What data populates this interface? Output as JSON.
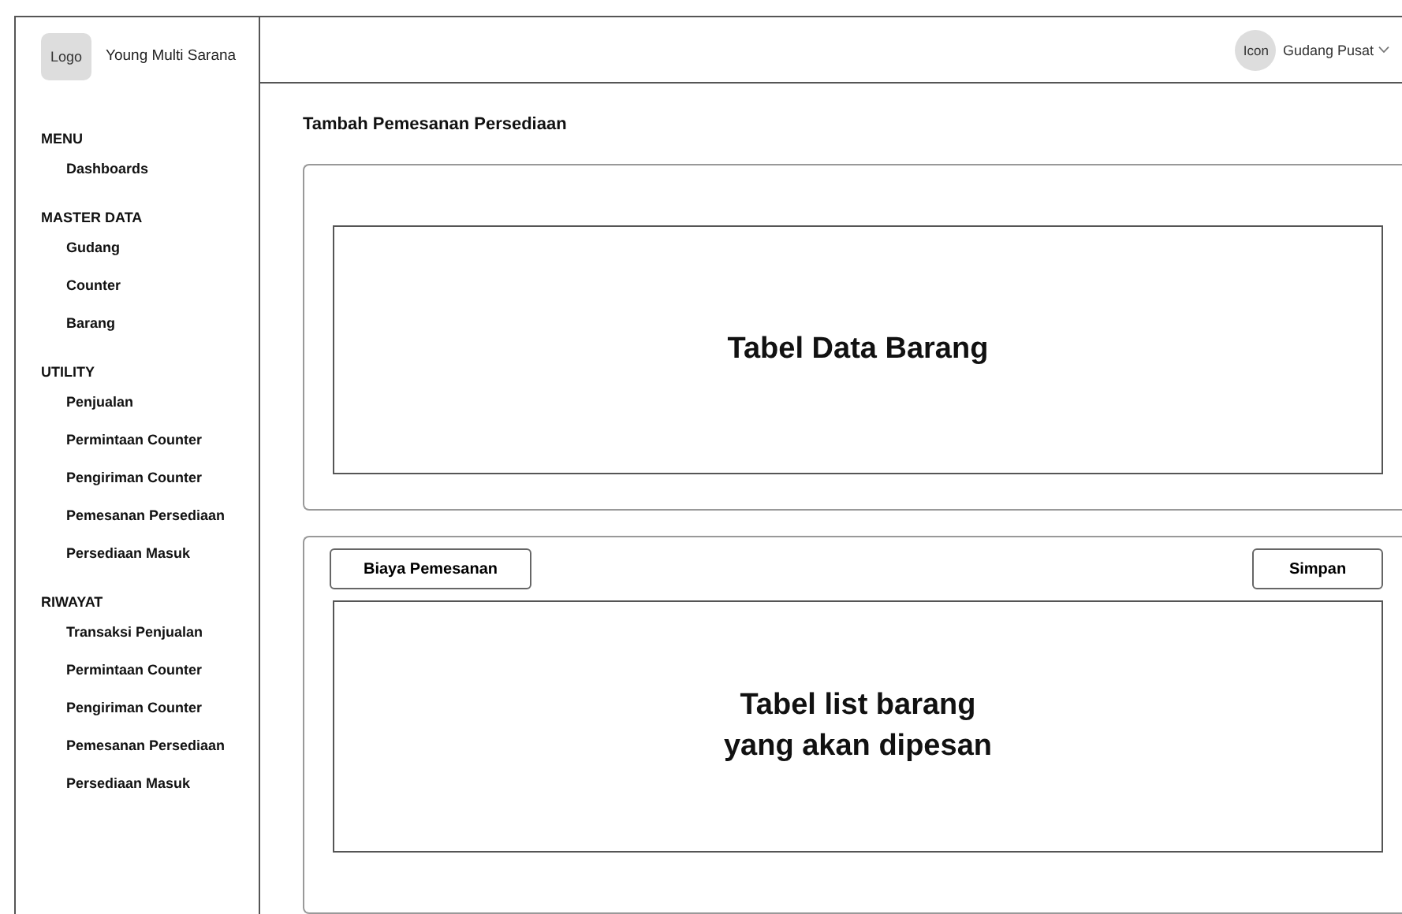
{
  "brand": {
    "logo": "Logo",
    "name": "Young Multi Sarana"
  },
  "header": {
    "avatar": "Icon",
    "user": "Gudang Pusat"
  },
  "sidebar": {
    "sections": [
      {
        "title": "MENU",
        "items": [
          "Dashboards"
        ]
      },
      {
        "title": "MASTER DATA",
        "items": [
          "Gudang",
          "Counter",
          "Barang"
        ]
      },
      {
        "title": "UTILITY",
        "items": [
          "Penjualan",
          "Permintaan Counter",
          "Pengiriman Counter",
          "Pemesanan Persediaan",
          "Persediaan Masuk"
        ]
      },
      {
        "title": "RIWAYAT",
        "items": [
          "Transaksi Penjualan",
          "Permintaan Counter",
          "Pengiriman Counter",
          "Pemesanan Persediaan",
          "Persediaan Masuk"
        ]
      }
    ]
  },
  "page_title": "Tambah Pemesanan Persediaan",
  "stock_table": {
    "placeholder": "Tabel Data Barang"
  },
  "order_panel": {
    "cost_button": "Biaya Pemesanan",
    "save_button": "Simpan",
    "placeholder": "Tabel list barang\nyang akan dipesan"
  }
}
